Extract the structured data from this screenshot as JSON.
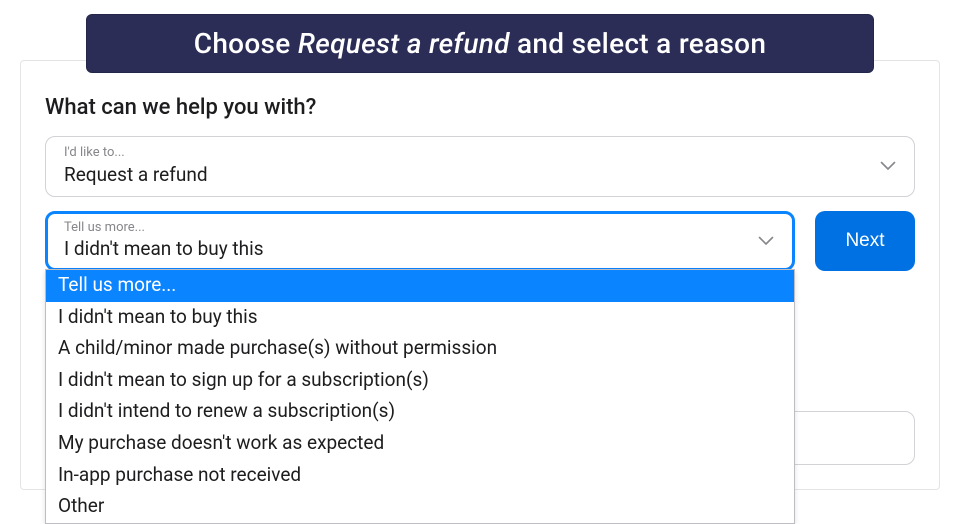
{
  "instruction": {
    "prefix": "Choose ",
    "emphasis": "Request a refund",
    "suffix": " and select a reason"
  },
  "form": {
    "heading": "What can we help you with?",
    "topic_select": {
      "label": "I'd like to...",
      "value": "Request a refund"
    },
    "reason_select": {
      "label": "Tell us more...",
      "value": "I didn't mean to buy this",
      "options": [
        "Tell us more...",
        "I didn't mean to buy this",
        "A child/minor made purchase(s) without permission",
        "I didn't mean to sign up for a subscription(s)",
        "I didn't intend to renew a subscription(s)",
        "My purchase doesn't work as expected",
        "In-app purchase not received",
        "Other"
      ],
      "highlighted_index": 0
    },
    "next_label": "Next"
  }
}
